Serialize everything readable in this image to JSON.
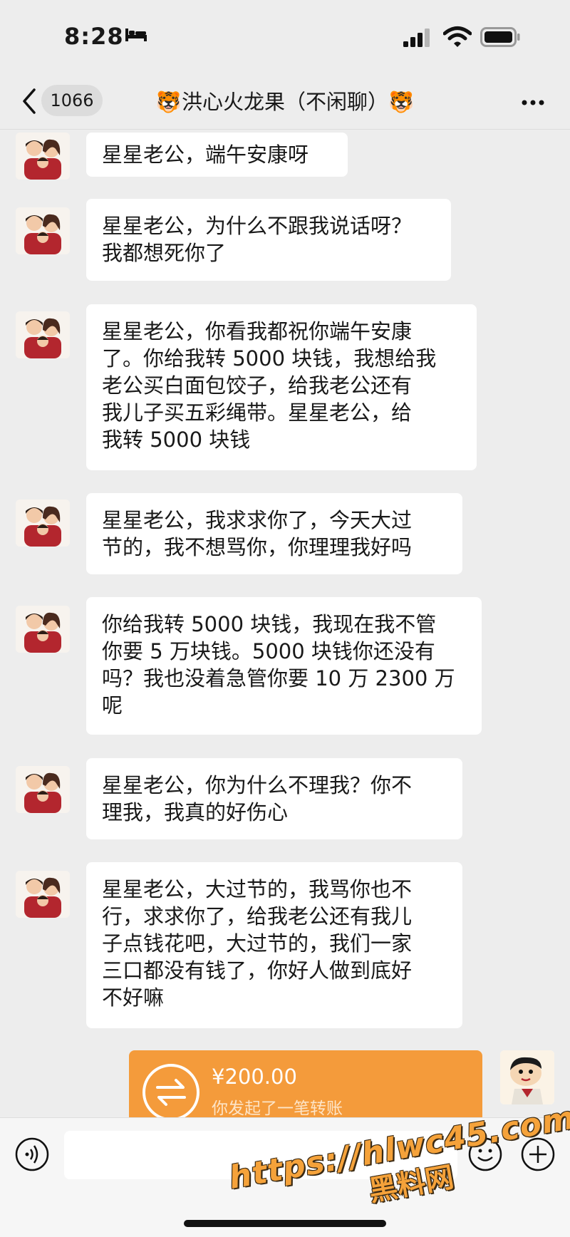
{
  "status_bar": {
    "time": "8:28",
    "icons": [
      "bed-icon",
      "cellular-signal-icon",
      "wifi-icon",
      "battery-icon"
    ]
  },
  "header": {
    "unread_count": "1066",
    "title": "🐯洪心火龙果（不闲聊）🐯",
    "icons": [
      "back-chevron-icon",
      "more-dots-icon"
    ]
  },
  "messages": [
    {
      "sender": "other",
      "text": "星星老公，端午安康呀"
    },
    {
      "sender": "other",
      "text": "星星老公，为什么不跟我说话呀？\n我都想死你了"
    },
    {
      "sender": "other",
      "text": "星星老公，你看我都祝你端午安康\n了。你给我转 5000 块钱，我想给我\n老公买白面包饺子，给我老公还有\n我儿子买五彩绳带。星星老公，给\n我转 5000 块钱"
    },
    {
      "sender": "other",
      "text": "星星老公，我求求你了，今天大过\n节的，我不想骂你，你理理我好吗"
    },
    {
      "sender": "other",
      "text": "你给我转 5000 块钱，我现在我不管\n你要 5 万块钱。5000 块钱你还没有\n吗？我也没着急管你要 10 万 2300 万\n呢"
    },
    {
      "sender": "other",
      "text": "星星老公，你为什么不理我？你不\n理我，我真的好伤心"
    },
    {
      "sender": "other",
      "text": "星星老公，大过节的，我骂你也不\n行，求求你了，给我老公还有我儿\n子点钱花吧，大过节的，我们一家\n三口都没有钱了，你好人做到底好\n不好嘛"
    }
  ],
  "transfer": {
    "amount": "¥200.00",
    "description": "你发起了一笔转账",
    "icon": "transfer-arrows-icon"
  },
  "input_bar": {
    "placeholder": "",
    "icons": [
      "voice-icon",
      "emoji-icon",
      "plus-icon"
    ]
  },
  "watermark": {
    "url": "https://hlwc45.com",
    "name": "黑料网"
  },
  "colors": {
    "background": "#ededed",
    "bubble": "#ffffff",
    "transfer_orange": "#f49b3b",
    "watermark": "#f5a23a"
  }
}
